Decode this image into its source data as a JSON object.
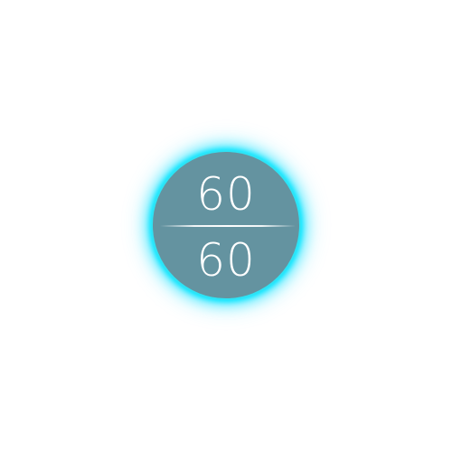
{
  "counter": {
    "top_value": "60",
    "bottom_value": "60"
  },
  "colors": {
    "page_background": "#ffffff",
    "orb_fill": "#6493a0",
    "glow": "#00e5ff",
    "text": "#ffffff"
  }
}
